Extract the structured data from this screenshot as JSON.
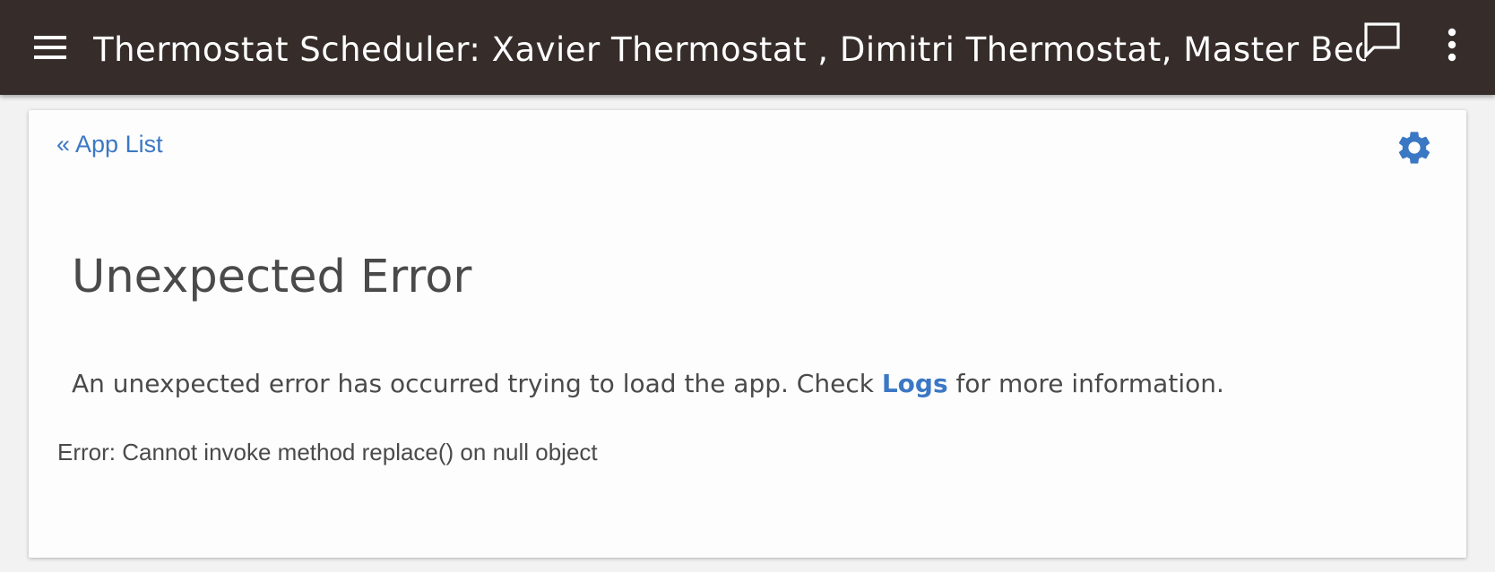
{
  "header": {
    "title": "Thermostat Scheduler: Xavier Thermostat , Dimitri Thermostat, Master Bedroom Thermostat",
    "menu_icon": "hamburger-menu-icon",
    "feedback_icon": "chat-bubble-icon",
    "more_icon": "more-vertical-icon"
  },
  "nav": {
    "back_link": "« App List",
    "settings_icon": "gear-icon"
  },
  "error": {
    "title": "Unexpected Error",
    "message_before": "An unexpected error has occurred trying to load the app. Check ",
    "logs_link": "Logs",
    "message_after": " for more information.",
    "detail": "Error: Cannot invoke method replace() on null object"
  },
  "colors": {
    "header_bg": "#362d2b",
    "link": "#3b78c4",
    "text": "#4a4a4a",
    "page_bg": "#f2f2f2",
    "card_bg": "#fdfdfd"
  }
}
